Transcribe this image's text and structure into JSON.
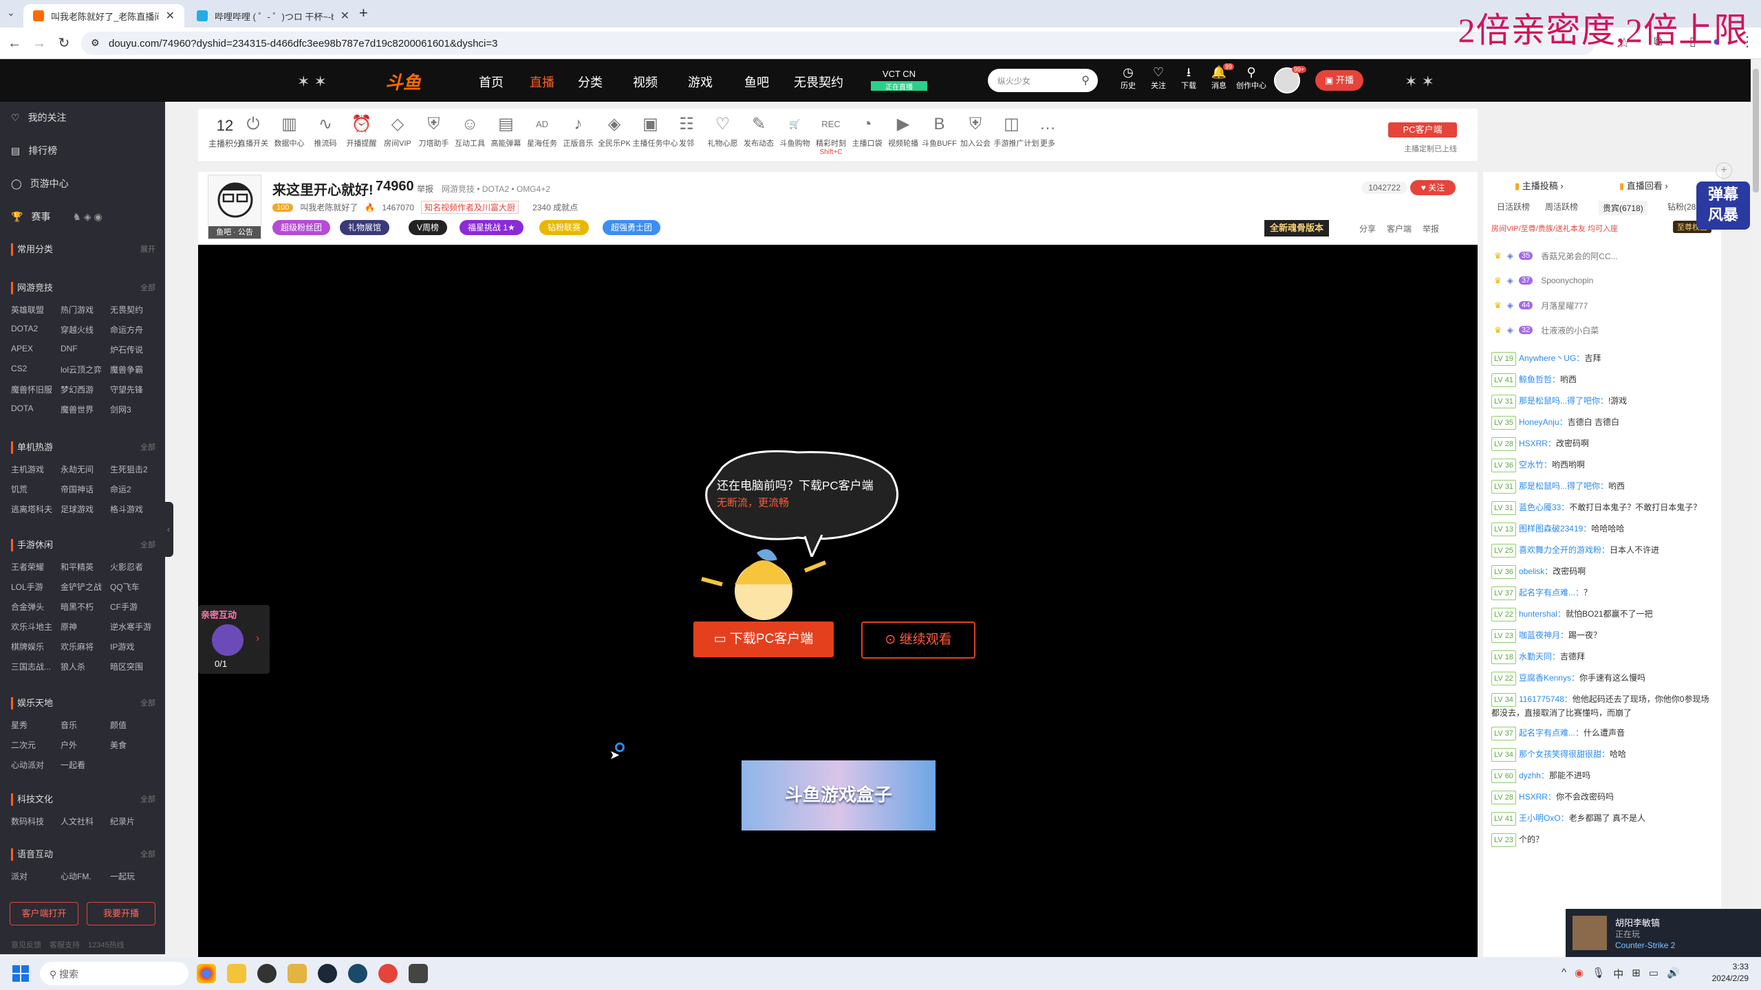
{
  "browser": {
    "tabs": [
      {
        "title": "叫我老陈就好了_老陈直播间74"
      },
      {
        "title": "哔哩哔哩 ( ゜- ゜)つロ 干杯~-bi"
      }
    ],
    "new_tab": "+",
    "url": "douyu.com/74960?dyshid=234315-d466dfc3ee98b787e7d19c8200061601&dyshci=3"
  },
  "overlay_promo": "2倍亲密度,2倍上限",
  "site_header": {
    "logo": "斗鱼",
    "nav": [
      "首页",
      "直播",
      "分类",
      "视频",
      "游戏",
      "鱼吧",
      "无畏契约"
    ],
    "active_nav": "直播",
    "vct": {
      "title": "VCT CN",
      "sub": "正在直播"
    },
    "search_placeholder": "纵火少女",
    "icons": [
      {
        "label": "历史",
        "icon": "clock-icon",
        "glyph": "◷"
      },
      {
        "label": "关注",
        "icon": "heart-icon",
        "glyph": "♡"
      },
      {
        "label": "下载",
        "icon": "download-icon",
        "glyph": "⭳"
      },
      {
        "label": "消息",
        "icon": "bell-icon",
        "glyph": "🔔",
        "badge": "99"
      },
      {
        "label": "创作中心",
        "icon": "bulb-icon",
        "glyph": "⚲"
      }
    ],
    "avatar_badge": "99+",
    "broadcast_btn": "开播"
  },
  "sidebar": {
    "top_items": [
      {
        "label": "我的关注",
        "icon": "heart-icon",
        "glyph": "♡"
      },
      {
        "label": "排行榜",
        "icon": "rank-icon",
        "glyph": "▤"
      },
      {
        "label": "页游中心",
        "icon": "game-icon",
        "glyph": "◯"
      },
      {
        "label": "赛事",
        "icon": "trophy-icon",
        "glyph": "🏆"
      }
    ],
    "common": {
      "title": "常用分类",
      "more": "展开"
    },
    "sections": [
      {
        "title": "网游竞技",
        "more": "全部",
        "items": [
          "英雄联盟",
          "热门游戏",
          "无畏契约",
          "DOTA2",
          "穿越火线",
          "命运方舟",
          "APEX",
          "DNF",
          "炉石传说",
          "CS2",
          "lol云顶之弈",
          "魔兽争霸",
          "魔兽怀旧服",
          "梦幻西游",
          "守望先锋",
          "DOTA",
          "魔兽世界",
          "剑网3"
        ]
      },
      {
        "title": "单机热游",
        "more": "全部",
        "items": [
          "主机游戏",
          "永劫无间",
          "生死狙击2",
          "饥荒",
          "帝国神话",
          "命运2",
          "逃离塔科夫",
          "足球游戏",
          "格斗游戏"
        ]
      },
      {
        "title": "手游休闲",
        "more": "全部",
        "items": [
          "王者荣耀",
          "和平精英",
          "火影忍者",
          "LOL手游",
          "金铲铲之战",
          "QQ飞车",
          "合金弹头",
          "暗黑不朽",
          "CF手游",
          "欢乐斗地主",
          "原神",
          "逆水寒手游",
          "棋牌娱乐",
          "欢乐麻将",
          "IP游戏",
          "三国志战...",
          "狼人杀",
          "暗区突围"
        ]
      },
      {
        "title": "娱乐天地",
        "more": "全部",
        "items": [
          "星秀",
          "音乐",
          "颜值",
          "二次元",
          "户外",
          "美食",
          "心动派对",
          "一起看"
        ]
      },
      {
        "title": "科技文化",
        "more": "全部",
        "items": [
          "数码科技",
          "人文社科",
          "纪录片"
        ]
      },
      {
        "title": "语音互动",
        "more": "全部",
        "items": [
          "派对",
          "心动FM.",
          "一起玩"
        ]
      }
    ],
    "btn_client": "客户端打开",
    "btn_broadcast": "我要开播",
    "footer": [
      "意见反馈",
      "客服支持",
      "12345热线"
    ]
  },
  "toolbar": {
    "score": "12",
    "score_label": "主播积分",
    "items": [
      "直播开关",
      "数据中心",
      "推流码",
      "开播提醒",
      "房间VIP",
      "刀塔助手",
      "互动工具",
      "高能弹幕",
      "星海任务",
      "正版音乐",
      "全民乐PK",
      "主播任务中心",
      "发邻",
      "礼物心愿",
      "发布动态",
      "斗鱼购物",
      "精彩时刻",
      "主播口袋",
      "视频轮播",
      "斗鱼BUFF",
      "加入公会",
      "手游推广计划",
      "更多"
    ],
    "shortcut": "Shift+C",
    "pc_client": "PC客户端",
    "pc_client_sub": "主播定制已上线"
  },
  "room": {
    "title": "来这里开心就好!",
    "room_id": "74960",
    "report": "举报",
    "category": "网游竞技 • DOTA2 • OMG4+2",
    "streamer": "叫我老陈就好了",
    "level": "100",
    "heat": "1467070",
    "tag": "知名视频作者及川富大厨",
    "viewers": "2340 成就点",
    "announce": "鱼吧 · 公告",
    "badges": [
      "超级粉丝团",
      "礼物展馆",
      "V周榜",
      "福星挑战 1★",
      "钻粉联赛",
      "超强勇士团"
    ],
    "follow_count": "1042722",
    "follow_btn": "关注",
    "version_btn": "全新魂骨版本",
    "actions": [
      "分享",
      "客户端",
      "举报"
    ]
  },
  "player": {
    "bubble_line1": "还在电脑前吗？下载PC客户端",
    "bubble_line2": "无断流，更流畅",
    "download_btn": "下载PC客户端",
    "watch_btn": "继续观看",
    "ad_text": "斗鱼游戏盒子",
    "interact_title": "亲密互动",
    "interact_progress": "0/1"
  },
  "chat": {
    "header_left": "主播投稿",
    "header_right": "直播回看",
    "tabs": [
      "日活跃榜",
      "周活跃榜",
      "贵宾(6718)",
      "钻粉(28"
    ],
    "notice": "房间VIP/至尊/贵族/送礼本友 均可入座",
    "notice_btn": "至尊权益",
    "rank": [
      {
        "fans": "35",
        "name": "香菇兄弟会的阿CC..."
      },
      {
        "fans": "37",
        "name": "Spoonychopin"
      },
      {
        "fans": "44",
        "name": "月落星曜777"
      },
      {
        "fans": "32",
        "name": "壮液液的小白菜"
      }
    ],
    "messages": [
      {
        "lv": "LV 19",
        "user": "Anywhere丶UG：",
        "text": "吉拜"
      },
      {
        "lv": "LV 41",
        "user": "鲸鱼哲哲：",
        "text": "哟西"
      },
      {
        "lv": "LV 31",
        "user": "那是松鼠吗...得了吧你：",
        "text": "!游戏"
      },
      {
        "lv": "LV 35",
        "user": "HoneyAnju：",
        "text": "吉德白 吉德白"
      },
      {
        "lv": "LV 28",
        "user": "HSXRR：",
        "text": "改密码啊"
      },
      {
        "lv": "LV 36",
        "user": "空水竹：",
        "text": "哟西哟啊"
      },
      {
        "lv": "LV 31",
        "user": "那是松鼠吗...得了吧你：",
        "text": "哟西"
      },
      {
        "lv": "LV 31",
        "user": "蓝色心魇33：",
        "text": "不敢打日本鬼子？不敢打日本鬼子？"
      },
      {
        "lv": "LV 13",
        "user": "图样图森破23419：",
        "text": "哈哈哈哈"
      },
      {
        "lv": "LV 25",
        "user": "喜欢舞力全开的游戏粉：",
        "text": "日本人不许进"
      },
      {
        "lv": "LV 36",
        "user": "obelisk：",
        "text": "改密码啊"
      },
      {
        "lv": "LV 37",
        "user": "起名字有点难...：",
        "text": "？"
      },
      {
        "lv": "LV 22",
        "user": "huntershal：",
        "text": "就怕BO21都赢不了一把"
      },
      {
        "lv": "LV 23",
        "user": "咖蓝夜神月：",
        "text": "踢一夜？"
      },
      {
        "lv": "LV 18",
        "user": "水勤天同：",
        "text": "吉德拜"
      },
      {
        "lv": "LV 22",
        "user": "豆腐香Kennys：",
        "text": "你手速有这么慢吗"
      },
      {
        "lv": "LV 34",
        "user": "1161775748：",
        "text": "他他起码还去了现场，你他你0参现场都没去，直接取消了比赛懂吗，而崩了"
      },
      {
        "lv": "LV 37",
        "user": "起名字有点难...：",
        "text": "什么遭声音"
      },
      {
        "lv": "LV 34",
        "user": "那个女孩笑得很甜很甜：",
        "text": "哈哈"
      },
      {
        "lv": "LV 60",
        "user": "dyzhh：",
        "text": "那能不进吗"
      },
      {
        "lv": "LV 28",
        "user": "HSXRR：",
        "text": "你不会改密码吗"
      },
      {
        "lv": "LV 41",
        "user": "王小明OxO：",
        "text": "老乡都踢了 真不是人"
      },
      {
        "lv": "LV 23",
        "user": "",
        "text": "个的？"
      }
    ]
  },
  "taskbar": {
    "search": "搜索",
    "ime": "中",
    "time": "3:33",
    "date": "2024/2/29"
  },
  "notification": {
    "name": "胡阳李敏镐",
    "status": "正在玩",
    "game": "Counter-Strike 2"
  }
}
